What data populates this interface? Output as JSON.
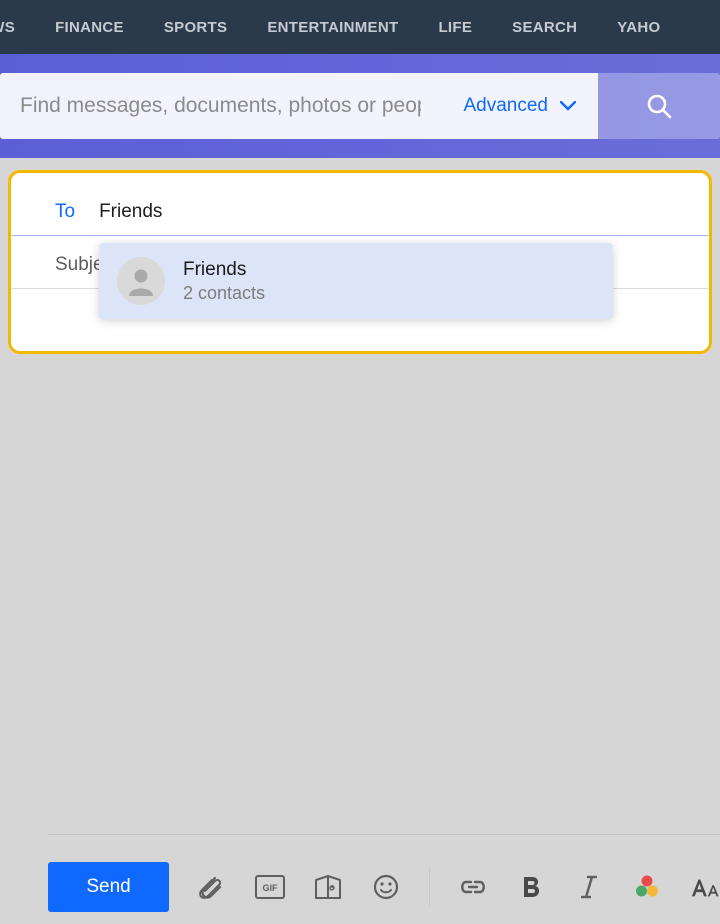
{
  "topnav": {
    "items": [
      "EWS",
      "FINANCE",
      "SPORTS",
      "ENTERTAINMENT",
      "LIFE",
      "SEARCH",
      "YAHO"
    ]
  },
  "search": {
    "placeholder": "Find messages, documents, photos or people",
    "advanced_label": "Advanced"
  },
  "compose": {
    "to_label": "To",
    "to_value": "Friends",
    "subject_label": "Subje"
  },
  "suggestion": {
    "title": "Friends",
    "subtitle": "2 contacts"
  },
  "bottombar": {
    "send_label": "Send"
  }
}
